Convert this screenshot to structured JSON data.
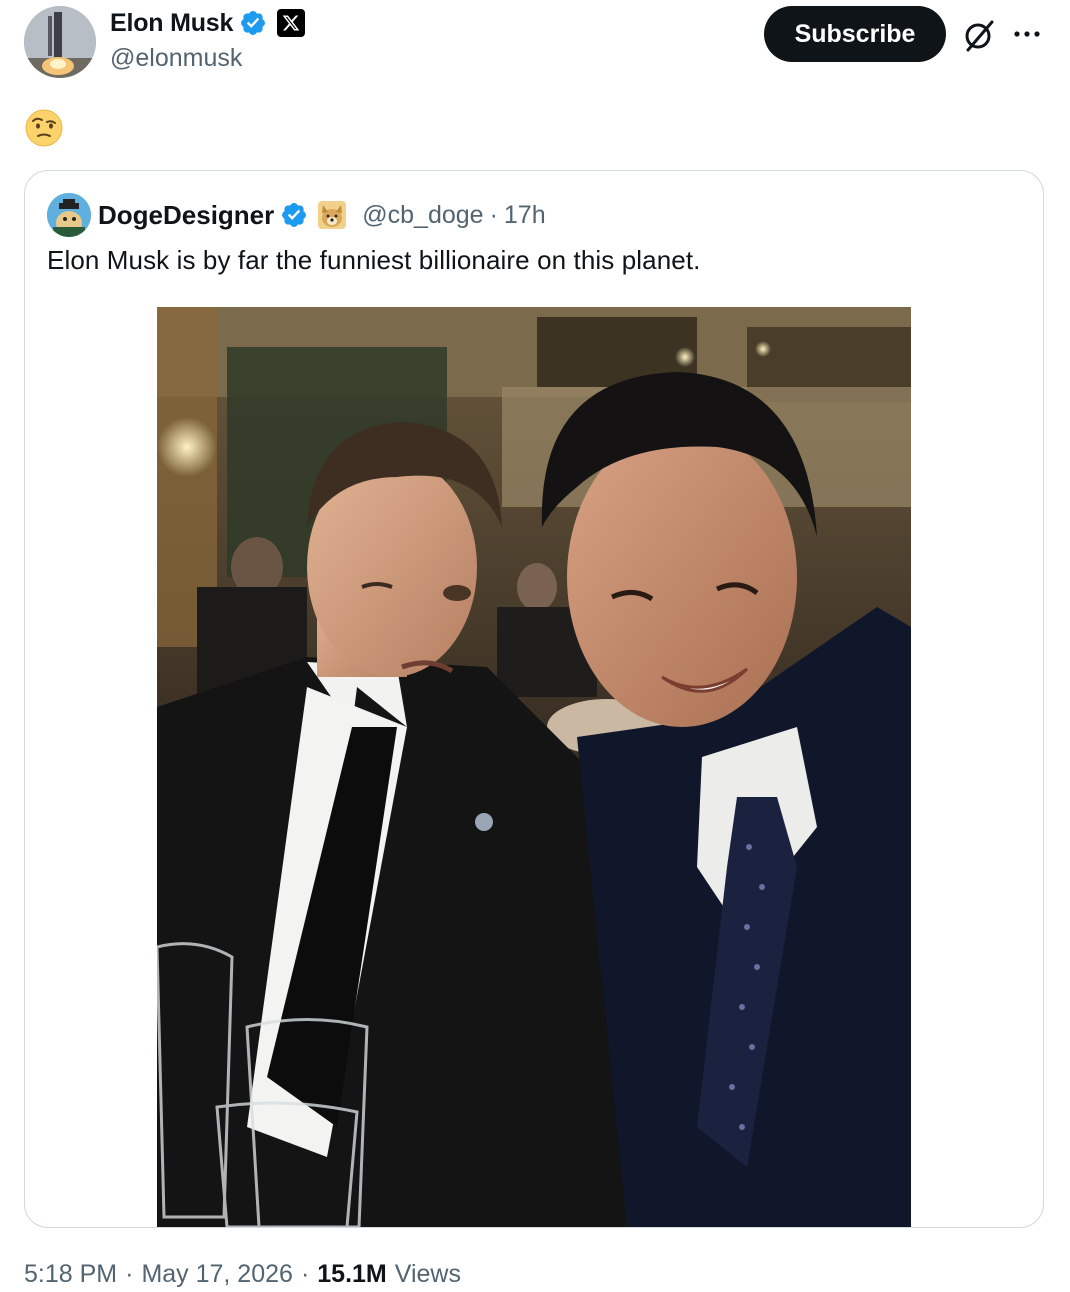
{
  "author": {
    "display_name": "Elon Musk",
    "handle": "@elonmusk",
    "verified_color": "#1d9bf0"
  },
  "actions": {
    "subscribe_label": "Subscribe",
    "grok_icon": "grok-icon",
    "more_icon": "more-icon"
  },
  "tweet": {
    "emoji": "🤨"
  },
  "quoted": {
    "display_name": "DogeDesigner",
    "handle": "@cb_doge",
    "separator": "·",
    "time": "17h",
    "text": "Elon Musk is by far the funniest billionaire on this planet."
  },
  "footer": {
    "time": "5:18 PM",
    "sep1": "·",
    "date": "May 17, 2026",
    "sep2": "·",
    "views_count": "15.1M",
    "views_label": "Views"
  }
}
